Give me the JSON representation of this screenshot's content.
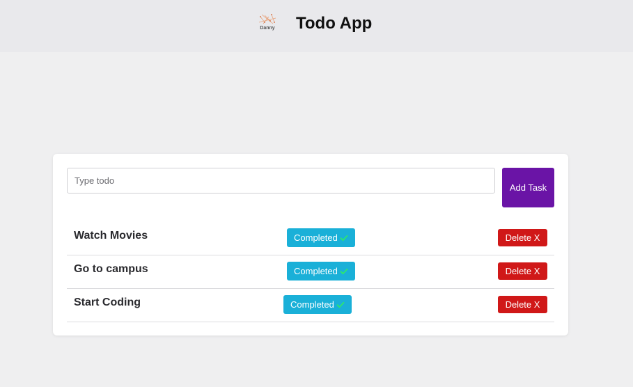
{
  "header": {
    "logo_text": "Danny",
    "title": "Todo App"
  },
  "form": {
    "input_placeholder": "Type todo",
    "input_value": "",
    "add_label": "Add Task"
  },
  "todos": [
    {
      "text": "Watch Movies",
      "status_label": "Completed",
      "delete_label": "Delete X"
    },
    {
      "text": "Go to campus",
      "status_label": "Completed",
      "delete_label": "Delete X"
    },
    {
      "text": "Start Coding",
      "status_label": "Completed",
      "delete_label": "Delete X"
    }
  ],
  "colors": {
    "add_button": "#6a14a6",
    "completed_button": "#1ab0d8",
    "delete_button": "#d01818",
    "check": "#2ee86a"
  }
}
